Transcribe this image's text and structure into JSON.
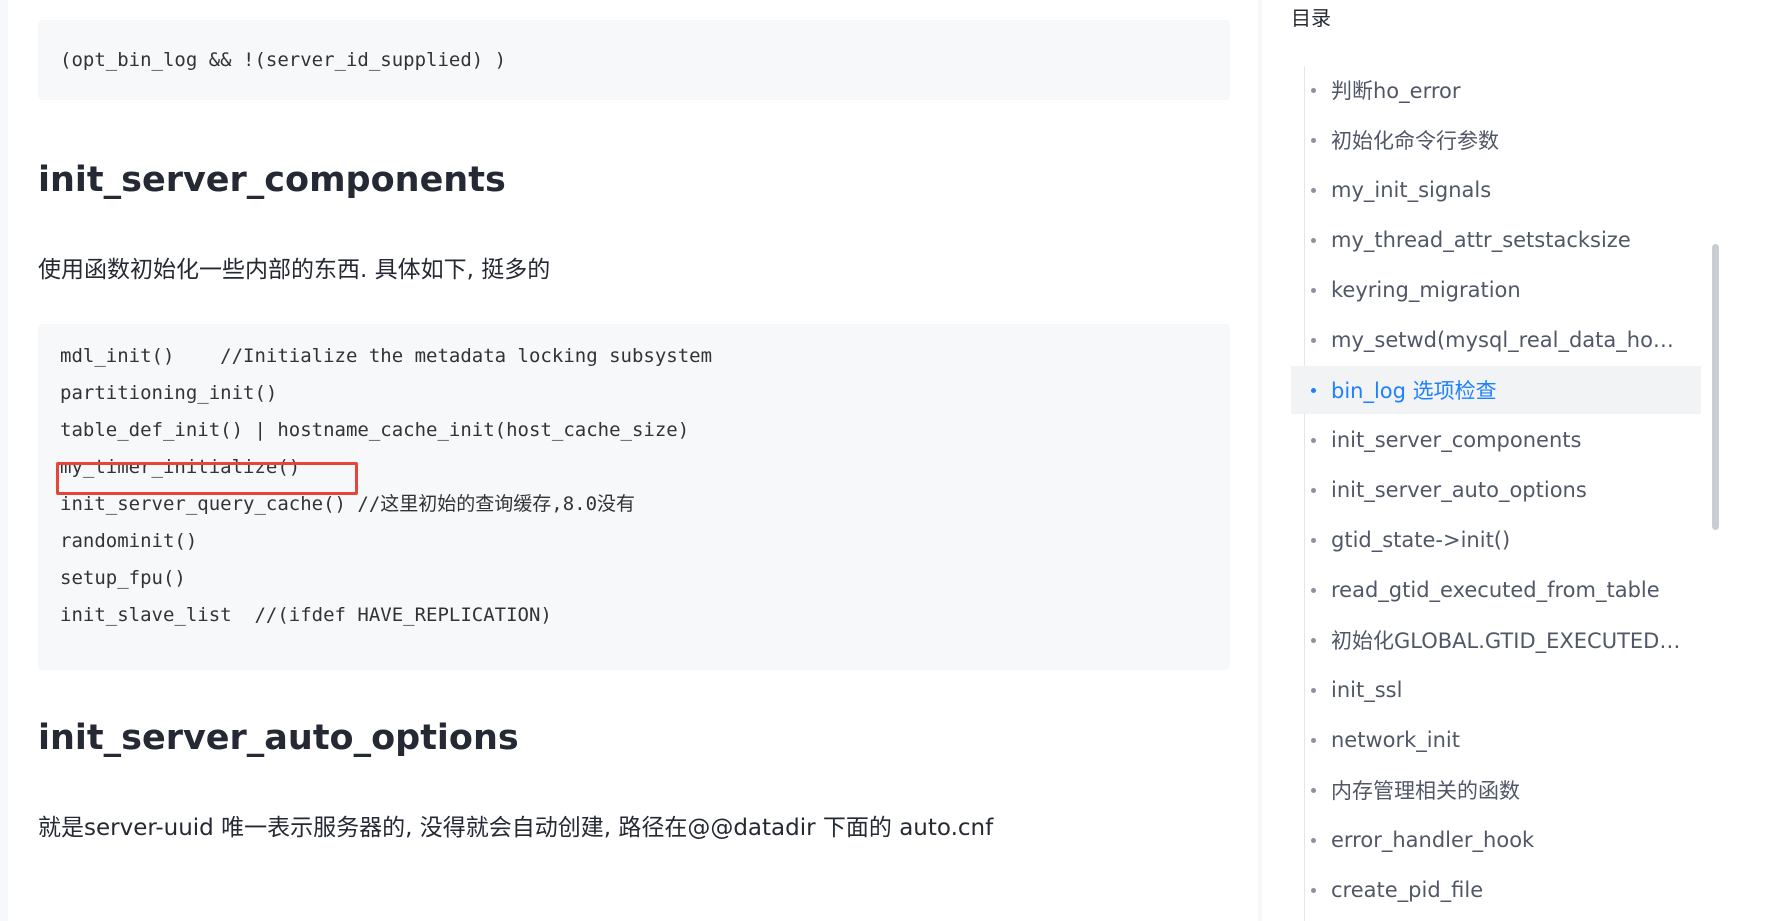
{
  "article": {
    "code_block_1": [
      "(opt_bin_log && !(server_id_supplied) )"
    ],
    "heading_1": "init_server_components",
    "paragraph_1": "使用函数初始化一些内部的东西. 具体如下, 挺多的",
    "code_block_2": [
      "mdl_init()    //Initialize the metadata locking subsystem",
      "partitioning_init()",
      "table_def_init() | hostname_cache_init(host_cache_size)",
      "my_timer_initialize()",
      "init_server_query_cache() //这里初始的查询缓存,8.0没有",
      "randominit()",
      "setup_fpu()",
      "init_slave_list  //(ifdef HAVE_REPLICATION)"
    ],
    "heading_2": "init_server_auto_options",
    "paragraph_2": "就是server-uuid 唯一表示服务器的, 没得就会自动创建, 路径在@@datadir 下面的 auto.cnf"
  },
  "toc": {
    "title": "目录",
    "items": [
      {
        "label": "判断ho_error",
        "active": false
      },
      {
        "label": "初始化命令行参数",
        "active": false
      },
      {
        "label": "my_init_signals",
        "active": false
      },
      {
        "label": "my_thread_attr_setstacksize",
        "active": false
      },
      {
        "label": "keyring_migration",
        "active": false
      },
      {
        "label": "my_setwd(mysql_real_data_home,...",
        "active": false
      },
      {
        "label": "bin_log 选项检查",
        "active": true
      },
      {
        "label": "init_server_components",
        "active": false
      },
      {
        "label": "init_server_auto_options",
        "active": false
      },
      {
        "label": "gtid_state->init()",
        "active": false
      },
      {
        "label": "read_gtid_executed_from_table",
        "active": false
      },
      {
        "label": "初始化GLOBAL.GTID_EXECUTED和...",
        "active": false
      },
      {
        "label": "init_ssl",
        "active": false
      },
      {
        "label": "network_init",
        "active": false
      },
      {
        "label": "内存管理相关的函数",
        "active": false
      },
      {
        "label": "error_handler_hook",
        "active": false
      },
      {
        "label": "create_pid_file",
        "active": false
      }
    ]
  },
  "colors": {
    "accent": "#1e80ff",
    "highlight_border": "#e8443a",
    "code_bg": "#f7f8fa"
  }
}
